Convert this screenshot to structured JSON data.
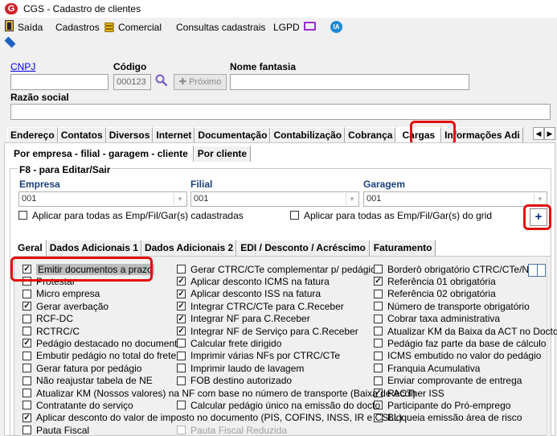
{
  "window": {
    "title": "CGS - Cadastro de clientes",
    "app_icon": "G"
  },
  "menu": {
    "items": [
      "Saída",
      "Cadastros",
      "Comercial",
      "Consultas cadastrais",
      "LGPD"
    ],
    "ia_label": "IA"
  },
  "form": {
    "cnpj_label": "CNPJ",
    "cnpj_value": "",
    "codigo_label": "Código",
    "codigo_value": "000123",
    "next_button": "Próximo",
    "nome_fantasia_label": "Nome fantasia",
    "nome_fantasia_value": "",
    "razao_social_label": "Razão social",
    "razao_social_value": ""
  },
  "main_tabs": [
    "Endereço",
    "Contatos",
    "Diversos",
    "Internet",
    "Documentação",
    "Contabilização",
    "Cobrança",
    "Cargas",
    "Informações Adi"
  ],
  "main_tabs_active": "Cargas",
  "sub_tabs": [
    "Por empresa - filial - garagem - cliente",
    "Por cliente"
  ],
  "sub_tabs_active": "Por empresa - filial - garagem - cliente",
  "edit_group": {
    "title": "F8 - para Editar/Sair",
    "empresa_label": "Empresa",
    "empresa_value": "001",
    "filial_label": "Filial",
    "filial_value": "001",
    "garagem_label": "Garagem",
    "garagem_value": "001",
    "apply_all_registered": "Aplicar para todas as Emp/Fil/Gar(s) cadastradas",
    "apply_all_grid": "Aplicar para todas as Emp/Fil/Gar(s) do grid",
    "plus_button": "+"
  },
  "inner_tabs": [
    "Geral",
    "Dados Adicionais 1",
    "Dados Adicionais 2",
    "EDI / Desconto / Acréscimo",
    "Faturamento"
  ],
  "inner_tabs_active": "Geral",
  "options": {
    "col1": [
      {
        "label": "Emitir documentos a prazo",
        "checked": true,
        "selected": true
      },
      {
        "label": "Protestar",
        "checked": false
      },
      {
        "label": "Micro empresa",
        "checked": false
      },
      {
        "label": "Gerar averbação",
        "checked": true
      },
      {
        "label": "RCF-DC",
        "checked": false
      },
      {
        "label": "RCTRC/C",
        "checked": false
      },
      {
        "label": "Pedágio destacado no documento",
        "checked": true
      },
      {
        "label": "Embutir pedágio no total do frete",
        "checked": false
      },
      {
        "label": "Gerar fatura por pedágio",
        "checked": false
      },
      {
        "label": "Não reajustar tabela de NE",
        "checked": false
      }
    ],
    "col2": [
      {
        "label": "Gerar CTRC/CTe complementar p/ pedágio",
        "checked": false
      },
      {
        "label": "Aplicar desconto ICMS na fatura",
        "checked": true
      },
      {
        "label": "Aplicar desconto ISS na fatura",
        "checked": true
      },
      {
        "label": "Integrar CTRC/CTe para C.Receber",
        "checked": true
      },
      {
        "label": "Integrar NF para C.Receber",
        "checked": true
      },
      {
        "label": "Integrar NF de Serviço para C.Receber",
        "checked": true
      },
      {
        "label": "Calcular frete dirigido",
        "checked": false
      },
      {
        "label": "Imprimir várias NFs por CTRC/CTe",
        "checked": false
      },
      {
        "label": "Imprimir laudo de lavagem",
        "checked": false
      },
      {
        "label": "FOB destino autorizado",
        "checked": false
      }
    ],
    "col3": [
      {
        "label": "Borderô obrigatório  CTRC/CTe/NF",
        "checked": false
      },
      {
        "label": "Referência 01 obrigatória",
        "checked": true
      },
      {
        "label": "Referência 02 obrigatória",
        "checked": false
      },
      {
        "label": "Número de transporte obrigatório",
        "checked": false
      },
      {
        "label": "Cobrar taxa administrativa",
        "checked": false
      },
      {
        "label": "Atualizar KM da Baixa da ACT no Docto",
        "checked": false
      },
      {
        "label": "Pedágio faz parte da base de cálculo",
        "checked": false
      },
      {
        "label": "ICMS embutido no valor do pedágio",
        "checked": false
      },
      {
        "label": "Franquia Acumulativa",
        "checked": false
      },
      {
        "label": "Enviar comprovante de entrega",
        "checked": false
      },
      {
        "label": "Recolher ISS",
        "checked": true
      },
      {
        "label": "Participante do Pró-emprego",
        "checked": false
      },
      {
        "label": "Bloqueia emissão área de risco",
        "checked": false
      }
    ],
    "wide": [
      {
        "label": "Atualizar KM (Nossos valores) na NF com base no número de transporte (Baixa de ACT)",
        "checked": false
      },
      {
        "label": "Contratante do serviço",
        "checked": false
      },
      {
        "label": "Aplicar desconto do valor de imposto no documento (PIS, COFINS, INSS, IR e CSLL)",
        "checked": true
      }
    ],
    "col2_wide": [
      {
        "label": "Calcular pedágio único na emissão do docto",
        "checked": false
      }
    ],
    "last_row": [
      {
        "label": "Pauta Fiscal",
        "checked": false,
        "disabled": false
      },
      {
        "label": "Pauta Fiscal Reduzida",
        "checked": false,
        "disabled": true
      }
    ]
  },
  "colors": {
    "highlight": "#e01010",
    "link": "#0000ee"
  }
}
